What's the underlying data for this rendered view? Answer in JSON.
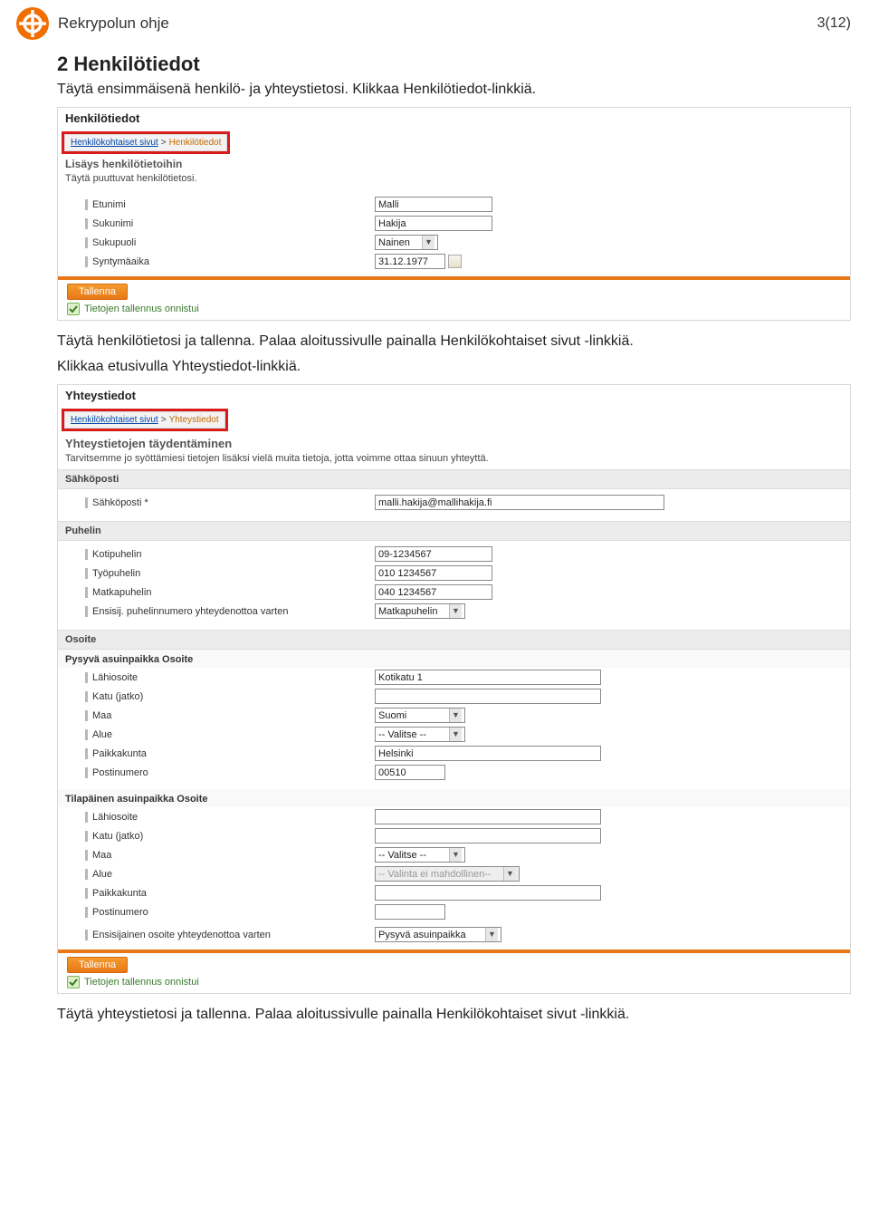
{
  "doc": {
    "title": "Rekrypolun ohje",
    "pagenum": "3(12)"
  },
  "section": {
    "heading": "2 Henkilötiedot",
    "p1": "Täytä ensimmäisenä henkilö- ja yhteystietosi. Klikkaa Henkilötiedot-linkkiä.",
    "p2": "Täytä henkilötietosi ja tallenna. Palaa aloitussivulle painalla Henkilökohtaiset sivut -linkkiä.",
    "p3": "Klikkaa etusivulla Yhteystiedot-linkkiä.",
    "p4": "Täytä yhteystietosi ja tallenna. Palaa aloitussivulle painalla Henkilökohtaiset sivut -linkkiä."
  },
  "ss1": {
    "topTitle": "Henkilötiedot",
    "bc_link": "Henkilökohtaiset sivut",
    "bc_cur": "Henkilötiedot",
    "subTitle": "Lisäys henkilötietoihin",
    "subNote": "Täytä puuttuvat henkilötietosi.",
    "row1_label": "Etunimi",
    "row1_val": "Malli",
    "row2_label": "Sukunimi",
    "row2_val": "Hakija",
    "row3_label": "Sukupuoli",
    "row3_val": "Nainen",
    "row4_label": "Syntymäaika",
    "row4_val": "31.12.1977",
    "btnSave": "Tallenna",
    "saveOk": "Tietojen tallennus onnistui"
  },
  "ss2": {
    "topTitle": "Yhteystiedot",
    "bc_link": "Henkilökohtaiset sivut",
    "bc_cur": "Yhteystiedot",
    "subTitle": "Yhteystietojen täydentäminen",
    "subNote": "Tarvitsemme jo syöttämiesi tietojen lisäksi vielä muita tietoja, jotta voimme ottaa sinuun yhteyttä.",
    "sec_email": "Sähköposti",
    "email_label": "Sähköposti *",
    "email_val": "malli.hakija@mallihakija.fi",
    "sec_phone": "Puhelin",
    "ph1_label": "Kotipuhelin",
    "ph1_val": "09-1234567",
    "ph2_label": "Työpuhelin",
    "ph2_val": "010 1234567",
    "ph3_label": "Matkapuhelin",
    "ph3_val": "040 1234567",
    "ph4_label": "Ensisij. puhelinnumero yhteydenottoa varten",
    "ph4_val": "Matkapuhelin",
    "sec_addr": "Osoite",
    "addr_perm_title": "Pysyvä asuinpaikka Osoite",
    "a1_label": "Lähiosoite",
    "a1_val": "Kotikatu 1",
    "a2_label": "Katu (jatko)",
    "a2_val": "",
    "a3_label": "Maa",
    "a3_val": "Suomi",
    "a4_label": "Alue",
    "a4_val": "-- Valitse --",
    "a5_label": "Paikkakunta",
    "a5_val": "Helsinki",
    "a6_label": "Postinumero",
    "a6_val": "00510",
    "addr_temp_title": "Tilapäinen asuinpaikka Osoite",
    "t1_label": "Lähiosoite",
    "t1_val": "",
    "t2_label": "Katu (jatko)",
    "t2_val": "",
    "t3_label": "Maa",
    "t3_val": "-- Valitse --",
    "t4_label": "Alue",
    "t4_val": "-- Valinta ei mahdollinen--",
    "t5_label": "Paikkakunta",
    "t5_val": "",
    "t6_label": "Postinumero",
    "t6_val": "",
    "t7_label": "Ensisijainen osoite yhteydenottoa varten",
    "t7_val": "Pysyvä asuinpaikka",
    "btnSave": "Tallenna",
    "saveOk": "Tietojen tallennus onnistui"
  }
}
